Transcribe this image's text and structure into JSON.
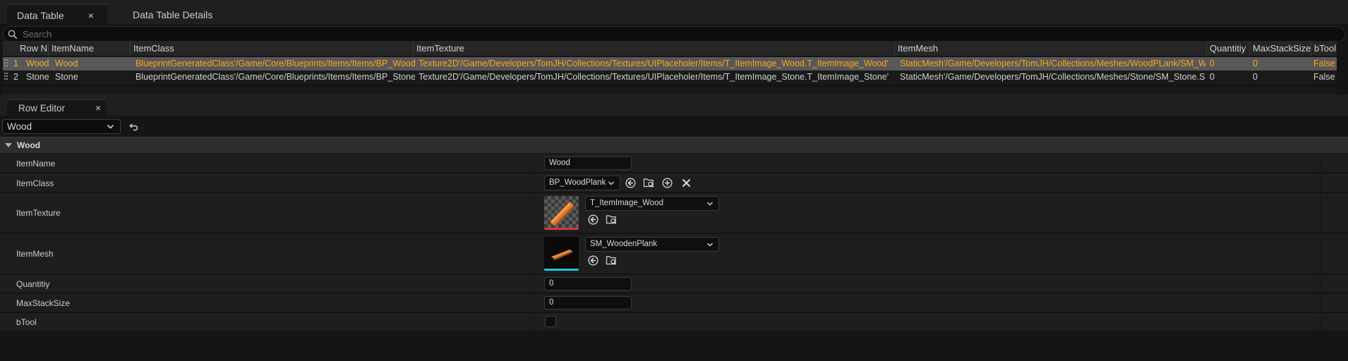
{
  "tabs": [
    {
      "label": "Data Table",
      "close": "×"
    },
    {
      "label": "Data Table Details"
    }
  ],
  "search": {
    "placeholder": "Search"
  },
  "table": {
    "columns": [
      "Row N",
      "ItemName",
      "ItemClass",
      "ItemTexture",
      "ItemMesh",
      "Quantitiy",
      "MaxStackSize",
      "bTool"
    ],
    "rows": [
      {
        "index": "1",
        "row_name": "Wood",
        "item_name": "Wood",
        "item_class": "BlueprintGeneratedClass'/Game/Core/Blueprints/Items/Items/BP_WoodP",
        "item_texture": "Texture2D'/Game/Developers/TomJH/Collections/Textures/UIPlaceholer/Items/T_ItemImage_Wood.T_ItemImage_Wood'",
        "item_mesh": "StaticMesh'/Game/Developers/TomJH/Collections/Meshes/WoodPLank/SM_Wo",
        "quantity": "0",
        "max_stack": "0",
        "btool": "False",
        "selected": true
      },
      {
        "index": "2",
        "row_name": "Stone",
        "item_name": "Stone",
        "item_class": "BlueprintGeneratedClass'/Game/Core/Blueprints/Items/Items/BP_Stone.",
        "item_texture": "Texture2D'/Game/Developers/TomJH/Collections/Textures/UIPlaceholer/Items/T_ItemImage_Stone.T_ItemImage_Stone'",
        "item_mesh": "StaticMesh'/Game/Developers/TomJH/Collections/Meshes/Stone/SM_Stone.SM_",
        "quantity": "0",
        "max_stack": "0",
        "btool": "False",
        "selected": false
      }
    ]
  },
  "row_editor": {
    "tab_label": "Row Editor",
    "close": "×",
    "selected_row": "Wood",
    "category": "Wood",
    "properties": {
      "item_name": {
        "label": "ItemName",
        "value": "Wood"
      },
      "item_class": {
        "label": "ItemClass",
        "value": "BP_WoodPlank"
      },
      "item_texture": {
        "label": "ItemTexture",
        "value": "T_ItemImage_Wood"
      },
      "item_mesh": {
        "label": "ItemMesh",
        "value": "SM_WoodenPlank"
      },
      "quantity": {
        "label": "Quantitiy",
        "value": "0"
      },
      "max_stack": {
        "label": "MaxStackSize",
        "value": "0"
      },
      "btool": {
        "label": "bTool",
        "checked": false
      }
    }
  },
  "colors": {
    "selected_row_text": "#ffa41a",
    "background": "#151515",
    "panel": "#1e1e1e",
    "mesh_underline": "#22c5e0",
    "texture_underline": "#d23a3a"
  },
  "icons": [
    "search-icon",
    "close-icon",
    "chevron-down-icon",
    "undo-icon",
    "use-selected-icon",
    "browse-icon",
    "add-icon",
    "clear-icon",
    "checkbox-icon"
  ]
}
